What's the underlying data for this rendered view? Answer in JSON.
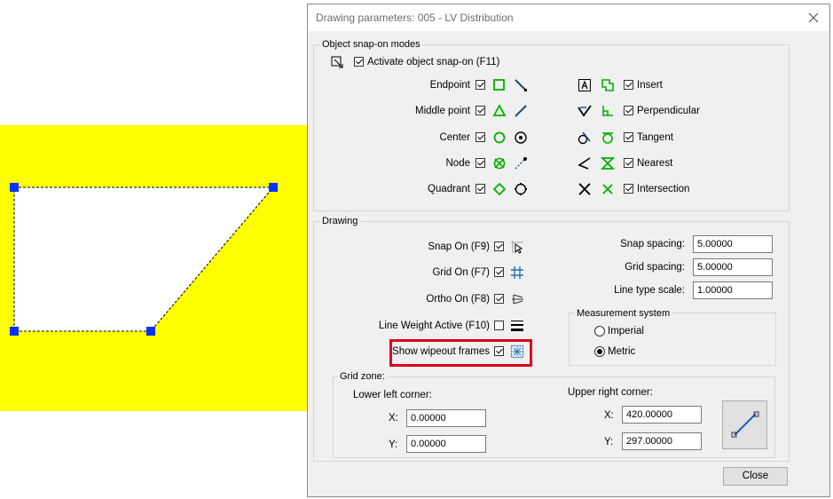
{
  "dialog": {
    "title": "Drawing parameters: 005 - LV Distribution",
    "close_button_label": "Close"
  },
  "snap_modes": {
    "group_label": "Object snap-on modes",
    "activate_label": "Activate object snap-on (F11)",
    "left": [
      {
        "label": "Endpoint",
        "icon": "square-marker-icon",
        "tool_icon": "endpoint-line-icon"
      },
      {
        "label": "Middle point",
        "icon": "triangle-marker-icon",
        "tool_icon": "midpoint-line-icon"
      },
      {
        "label": "Center",
        "icon": "circle-marker-icon",
        "tool_icon": "center-target-icon"
      },
      {
        "label": "Node",
        "icon": "node-x-marker-icon",
        "tool_icon": "node-dots-icon"
      },
      {
        "label": "Quadrant",
        "icon": "diamond-marker-icon",
        "tool_icon": "quadrant-circle-icon"
      }
    ],
    "right": [
      {
        "label": "Insert",
        "icon": "insert-marker-icon",
        "tool_icon": "insert-text-icon"
      },
      {
        "label": "Perpendicular",
        "icon": "perpendicular-marker-icon",
        "tool_icon": "perpendicular-tool-icon"
      },
      {
        "label": "Tangent",
        "icon": "tangent-marker-icon",
        "tool_icon": "tangent-tool-icon"
      },
      {
        "label": "Nearest",
        "icon": "hourglass-marker-icon",
        "tool_icon": "nearest-tool-icon"
      },
      {
        "label": "Intersection",
        "icon": "x-marker-icon",
        "tool_icon": "intersection-tool-icon"
      }
    ]
  },
  "drawing": {
    "group_label": "Drawing",
    "snap_on": "Snap On (F9)",
    "grid_on": "Grid On (F7)",
    "ortho_on": "Ortho On (F8)",
    "line_weight": "Line Weight Active (F10)",
    "show_wipeout": "Show wipeout frames",
    "snap_spacing_label": "Snap spacing:",
    "snap_spacing_value": "5.00000",
    "grid_spacing_label": "Grid spacing:",
    "grid_spacing_value": "5.00000",
    "line_type_scale_label": "Line type scale:",
    "line_type_scale_value": "1.00000",
    "measurement_label": "Measurement system",
    "imperial_label": "Imperial",
    "metric_label": "Metric"
  },
  "grid_zone": {
    "group_label": "Grid zone:",
    "lower_left_label": "Lower left corner:",
    "upper_right_label": "Upper right corner:",
    "x_label": "X:",
    "y_label": "Y:",
    "ll_x": "0.00000",
    "ll_y": "0.00000",
    "ur_x": "420.00000",
    "ur_y": "297.00000"
  },
  "colors": {
    "snap_green": "#00b000",
    "highlight_red": "#e0001b",
    "grip_blue": "#0033ff",
    "canvas_yellow": "#ffff00"
  }
}
